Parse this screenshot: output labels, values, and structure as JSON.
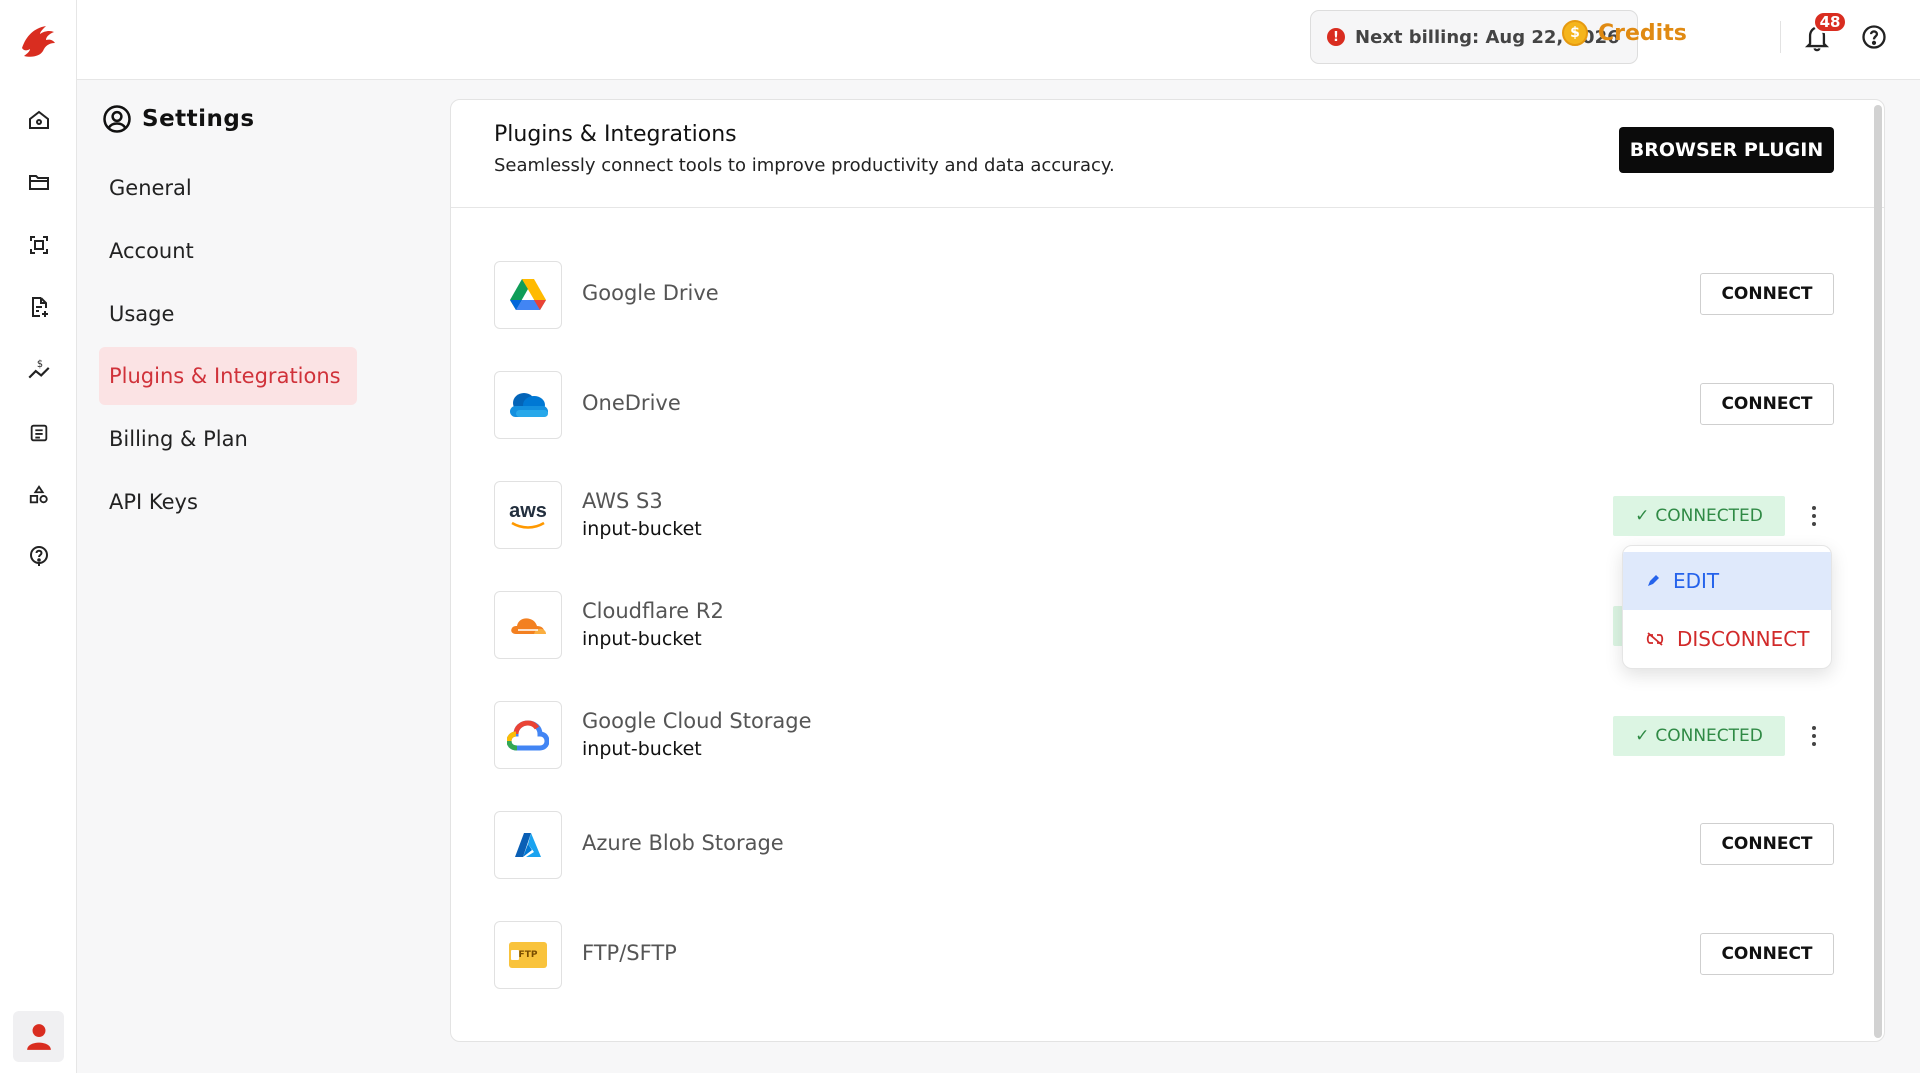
{
  "topbar": {
    "billing_text": "Next billing: Aug 22, 2026",
    "billing_icon": "!",
    "credits_label": "Credits",
    "credits_icon": "$",
    "notifications_count": "48"
  },
  "settings": {
    "title": "Settings",
    "nav": [
      {
        "label": "General"
      },
      {
        "label": "Account"
      },
      {
        "label": "Usage"
      },
      {
        "label": "Plugins & Integrations"
      },
      {
        "label": "Billing & Plan"
      },
      {
        "label": "API Keys"
      }
    ]
  },
  "main": {
    "title": "Plugins & Integrations",
    "subtitle": "Seamlessly connect tools to improve productivity and data accuracy.",
    "browser_plugin_label": "BROWSER PLUGIN",
    "connect_label": "CONNECT",
    "connected_label": "CONNECTED",
    "check": "✓",
    "integrations": [
      {
        "name": "Google Drive",
        "status": "disconnected"
      },
      {
        "name": "OneDrive",
        "status": "disconnected"
      },
      {
        "name": "AWS S3",
        "bucket": "input-bucket",
        "status": "connected",
        "logo_text": "aws"
      },
      {
        "name": "Cloudflare R2",
        "bucket": "input-bucket",
        "status": "connected"
      },
      {
        "name": "Google Cloud Storage",
        "bucket": "input-bucket",
        "status": "connected"
      },
      {
        "name": "Azure Blob Storage",
        "status": "disconnected"
      },
      {
        "name": "FTP/SFTP",
        "status": "disconnected",
        "logo_text": "FTP"
      }
    ]
  },
  "menu": {
    "edit_label": "EDIT",
    "disconnect_label": "DISCONNECT"
  },
  "colors": {
    "brand_red": "#d0323a",
    "connected_bg": "#dcf5e3",
    "connected_text": "#2f8a45",
    "credits": "#e08a12"
  }
}
